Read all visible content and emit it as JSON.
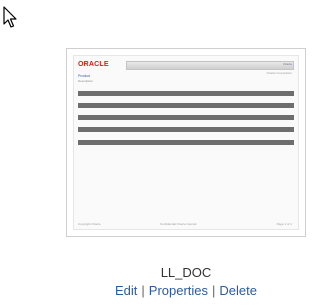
{
  "cursor": {
    "icon": "arrow-pointer-icon"
  },
  "document": {
    "name": "LL_DOC",
    "preview": {
      "logo": "ORACLE",
      "header_link": "Oracle",
      "header_subtext": "Oracle Corporation",
      "title": "Product",
      "title_sub": "Description",
      "footer_left": "Copyright Oracle",
      "footer_center": "Confidential Oracle Internal",
      "footer_right": "Page 1 of 1",
      "bar_count": 5
    }
  },
  "actions": {
    "edit": "Edit",
    "properties": "Properties",
    "delete": "Delete",
    "separator": "|"
  },
  "colors": {
    "link": "#2c5aa0",
    "logo": "#d0211c",
    "bar": "#6e6e6e"
  }
}
